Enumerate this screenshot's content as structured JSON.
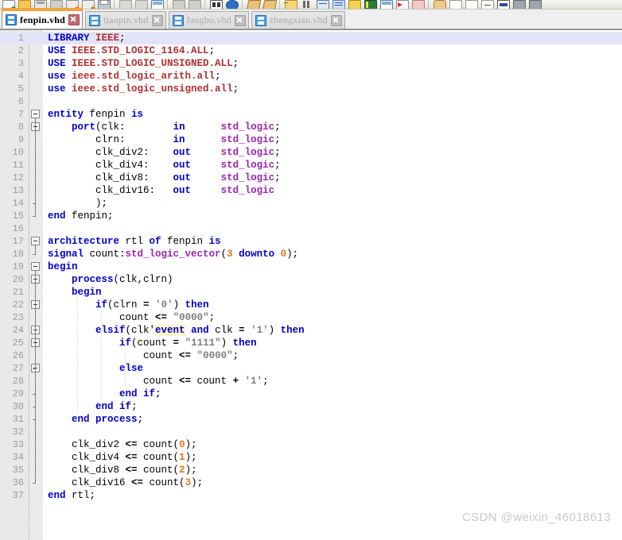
{
  "toolbar": {
    "name": "main-toolbar",
    "icons": [
      "new-file-icon",
      "open-folder-icon",
      "save-icon",
      "save-all-icon",
      "print-preview-icon",
      "print-setup-icon",
      "print-icon",
      "sep",
      "cut-icon",
      "copy-icon",
      "paste-icon",
      "sep",
      "undo-icon",
      "redo-icon",
      "sep",
      "find-icon",
      "find-replace-icon",
      "sep",
      "insert-template-icon",
      "insert-signal-icon",
      "sep",
      "compile-add-icon",
      "pause-icon",
      "simulate-icon",
      "run-icon",
      "waveform-icon",
      "report-icon",
      "delete-icon",
      "stop-icon",
      "hand-icon",
      "sep",
      "panel-1-icon",
      "panel-2-icon",
      "panel-3-icon",
      "panel-4-icon",
      "panel-5-icon"
    ]
  },
  "tabs": [
    {
      "label": "fenpin.vhd",
      "active": true,
      "icon": "file-save-icon",
      "close": "close-icon"
    },
    {
      "label": "tiaopin.vhd",
      "active": false,
      "icon": "file-save-icon",
      "close": "close-icon"
    },
    {
      "label": "fangbo.vhd",
      "active": false,
      "icon": "file-save-icon",
      "close": "close-icon"
    },
    {
      "label": "zhengxian.vhd",
      "active": false,
      "icon": "file-save-icon",
      "close": "close-icon"
    }
  ],
  "editor": {
    "name": "vhdl-source-editor",
    "current_line": 1,
    "total_lines": 37,
    "colors": {
      "current_line_bg": "#e4e4f8",
      "keyword": "#0000d0",
      "type": "#9c27b0",
      "library": "#b03030",
      "number": "#e07a1f",
      "string": "#808080",
      "search_highlight_bg": "#fbf6c4",
      "gutter_bg": "#e9e9e9",
      "line_number": "#9b9b9b"
    },
    "lines": [
      {
        "n": 1,
        "tokens": [
          {
            "t": "LIBRARY",
            "c": "kw"
          },
          {
            "t": " ",
            "c": "pl"
          },
          {
            "t": "IEEE",
            "c": "lib"
          },
          {
            "t": ";",
            "c": "pl"
          }
        ]
      },
      {
        "n": 2,
        "tokens": [
          {
            "t": "USE",
            "c": "kw"
          },
          {
            "t": " ",
            "c": "pl"
          },
          {
            "t": "IEEE.STD_LOGIC_1164.ALL",
            "c": "lib"
          },
          {
            "t": ";",
            "c": "pl"
          }
        ]
      },
      {
        "n": 3,
        "tokens": [
          {
            "t": "USE",
            "c": "kw"
          },
          {
            "t": " ",
            "c": "pl"
          },
          {
            "t": "IEEE.STD_LOGIC_UNSIGNED.ALL",
            "c": "lib"
          },
          {
            "t": ";",
            "c": "pl"
          }
        ]
      },
      {
        "n": 4,
        "tokens": [
          {
            "t": "use",
            "c": "kw"
          },
          {
            "t": " ",
            "c": "pl"
          },
          {
            "t": "ieee.std_logic_arith.all",
            "c": "lib"
          },
          {
            "t": ";",
            "c": "pl"
          }
        ]
      },
      {
        "n": 5,
        "tokens": [
          {
            "t": "use",
            "c": "kw"
          },
          {
            "t": " ",
            "c": "pl"
          },
          {
            "t": "ieee.std_logic_unsigned.all",
            "c": "lib"
          },
          {
            "t": ";",
            "c": "pl"
          }
        ]
      },
      {
        "n": 6,
        "tokens": []
      },
      {
        "n": 7,
        "tokens": [
          {
            "t": "entity",
            "c": "kw"
          },
          {
            "t": " fenpin ",
            "c": "pl"
          },
          {
            "t": "is",
            "c": "kw"
          }
        ]
      },
      {
        "n": 8,
        "tokens": [
          {
            "t": "    ",
            "c": "pl"
          },
          {
            "t": "port",
            "c": "kw"
          },
          {
            "t": "(clk:        ",
            "c": "pl"
          },
          {
            "t": "in",
            "c": "kw"
          },
          {
            "t": "      ",
            "c": "pl"
          },
          {
            "t": "std_logic",
            "c": "ty"
          },
          {
            "t": ";",
            "c": "pl"
          }
        ]
      },
      {
        "n": 9,
        "tokens": [
          {
            "t": "        clrn:        ",
            "c": "pl"
          },
          {
            "t": "in",
            "c": "kw"
          },
          {
            "t": "      ",
            "c": "pl"
          },
          {
            "t": "std_logic",
            "c": "ty"
          },
          {
            "t": ";",
            "c": "pl"
          }
        ]
      },
      {
        "n": 10,
        "tokens": [
          {
            "t": "        clk_div2:    ",
            "c": "pl"
          },
          {
            "t": "out",
            "c": "kw"
          },
          {
            "t": "     ",
            "c": "pl"
          },
          {
            "t": "std_logic",
            "c": "ty"
          },
          {
            "t": ";",
            "c": "pl"
          }
        ]
      },
      {
        "n": 11,
        "tokens": [
          {
            "t": "        clk_div4:    ",
            "c": "pl"
          },
          {
            "t": "out",
            "c": "kw"
          },
          {
            "t": "     ",
            "c": "pl"
          },
          {
            "t": "std_logic",
            "c": "ty"
          },
          {
            "t": ";",
            "c": "pl"
          }
        ]
      },
      {
        "n": 12,
        "tokens": [
          {
            "t": "        clk_div8:    ",
            "c": "pl"
          },
          {
            "t": "out",
            "c": "kw"
          },
          {
            "t": "     ",
            "c": "pl"
          },
          {
            "t": "std_logic",
            "c": "ty"
          },
          {
            "t": ";",
            "c": "pl"
          }
        ]
      },
      {
        "n": 13,
        "tokens": [
          {
            "t": "        clk_div16:   ",
            "c": "pl"
          },
          {
            "t": "out",
            "c": "kw"
          },
          {
            "t": "     ",
            "c": "pl"
          },
          {
            "t": "std_logic",
            "c": "ty"
          }
        ]
      },
      {
        "n": 14,
        "tokens": [
          {
            "t": "        );",
            "c": "pl"
          }
        ]
      },
      {
        "n": 15,
        "tokens": [
          {
            "t": "end",
            "c": "kw"
          },
          {
            "t": " fenpin;",
            "c": "pl"
          }
        ]
      },
      {
        "n": 16,
        "tokens": []
      },
      {
        "n": 17,
        "tokens": [
          {
            "t": "architecture",
            "c": "kw"
          },
          {
            "t": " rtl ",
            "c": "pl"
          },
          {
            "t": "of",
            "c": "kw"
          },
          {
            "t": " fenpin ",
            "c": "pl"
          },
          {
            "t": "is",
            "c": "kw"
          }
        ]
      },
      {
        "n": 18,
        "tokens": [
          {
            "t": "signal",
            "c": "kw"
          },
          {
            "t": " count:",
            "c": "pl"
          },
          {
            "t": "std_logic_vector",
            "c": "ty"
          },
          {
            "t": "(",
            "c": "pl"
          },
          {
            "t": "3",
            "c": "num"
          },
          {
            "t": " ",
            "c": "pl"
          },
          {
            "t": "downto",
            "c": "kw"
          },
          {
            "t": " ",
            "c": "pl"
          },
          {
            "t": "0",
            "c": "num"
          },
          {
            "t": ");",
            "c": "pl"
          }
        ]
      },
      {
        "n": 19,
        "tokens": [
          {
            "t": "begin",
            "c": "kw"
          }
        ]
      },
      {
        "n": 20,
        "tokens": [
          {
            "t": "    ",
            "c": "pl"
          },
          {
            "t": "process",
            "c": "kw"
          },
          {
            "t": "(clk,clrn)",
            "c": "pl"
          }
        ]
      },
      {
        "n": 21,
        "tokens": [
          {
            "t": "    ",
            "c": "pl"
          },
          {
            "t": "begin",
            "c": "kw"
          }
        ]
      },
      {
        "n": 22,
        "tokens": [
          {
            "t": "        ",
            "c": "pl"
          },
          {
            "t": "if",
            "c": "kw"
          },
          {
            "t": "(clrn ",
            "c": "pl"
          },
          {
            "t": "=",
            "c": "op"
          },
          {
            "t": " ",
            "c": "pl"
          },
          {
            "t": "'0'",
            "c": "str"
          },
          {
            "t": ") ",
            "c": "pl"
          },
          {
            "t": "then",
            "c": "kw"
          }
        ]
      },
      {
        "n": 23,
        "tokens": [
          {
            "t": "            count ",
            "c": "pl"
          },
          {
            "t": "<=",
            "c": "op"
          },
          {
            "t": " ",
            "c": "pl"
          },
          {
            "t": "\"0000\"",
            "c": "str"
          },
          {
            "t": ";",
            "c": "pl"
          }
        ]
      },
      {
        "n": 24,
        "tokens": [
          {
            "t": "        ",
            "c": "pl"
          },
          {
            "t": "elsif",
            "c": "kw"
          },
          {
            "t": "(clk'",
            "c": "pl"
          },
          {
            "t": "event",
            "c": "kw hl"
          },
          {
            "t": " ",
            "c": "pl"
          },
          {
            "t": "and",
            "c": "kw"
          },
          {
            "t": " clk ",
            "c": "pl"
          },
          {
            "t": "=",
            "c": "op"
          },
          {
            "t": " ",
            "c": "pl"
          },
          {
            "t": "'1'",
            "c": "str"
          },
          {
            "t": ") ",
            "c": "pl"
          },
          {
            "t": "then",
            "c": "kw"
          }
        ]
      },
      {
        "n": 25,
        "tokens": [
          {
            "t": "            ",
            "c": "pl"
          },
          {
            "t": "if",
            "c": "kw"
          },
          {
            "t": "(count ",
            "c": "pl"
          },
          {
            "t": "=",
            "c": "op"
          },
          {
            "t": " ",
            "c": "pl"
          },
          {
            "t": "\"1111\"",
            "c": "str"
          },
          {
            "t": ") ",
            "c": "pl"
          },
          {
            "t": "then",
            "c": "kw"
          }
        ]
      },
      {
        "n": 26,
        "tokens": [
          {
            "t": "                count ",
            "c": "pl"
          },
          {
            "t": "<=",
            "c": "op"
          },
          {
            "t": " ",
            "c": "pl"
          },
          {
            "t": "\"0000\"",
            "c": "str"
          },
          {
            "t": ";",
            "c": "pl"
          }
        ]
      },
      {
        "n": 27,
        "tokens": [
          {
            "t": "            ",
            "c": "pl"
          },
          {
            "t": "else",
            "c": "kw"
          }
        ]
      },
      {
        "n": 28,
        "tokens": [
          {
            "t": "                count ",
            "c": "pl"
          },
          {
            "t": "<=",
            "c": "op"
          },
          {
            "t": " count ",
            "c": "pl"
          },
          {
            "t": "+",
            "c": "op"
          },
          {
            "t": " ",
            "c": "pl"
          },
          {
            "t": "'1'",
            "c": "str"
          },
          {
            "t": ";",
            "c": "pl"
          }
        ]
      },
      {
        "n": 29,
        "tokens": [
          {
            "t": "            ",
            "c": "pl"
          },
          {
            "t": "end",
            "c": "kw"
          },
          {
            "t": " ",
            "c": "pl"
          },
          {
            "t": "if",
            "c": "kw"
          },
          {
            "t": ";",
            "c": "pl"
          }
        ]
      },
      {
        "n": 30,
        "tokens": [
          {
            "t": "        ",
            "c": "pl"
          },
          {
            "t": "end",
            "c": "kw"
          },
          {
            "t": " ",
            "c": "pl"
          },
          {
            "t": "if",
            "c": "kw"
          },
          {
            "t": ";",
            "c": "pl"
          }
        ]
      },
      {
        "n": 31,
        "tokens": [
          {
            "t": "    ",
            "c": "pl"
          },
          {
            "t": "end",
            "c": "kw"
          },
          {
            "t": " ",
            "c": "pl"
          },
          {
            "t": "process",
            "c": "kw"
          },
          {
            "t": ";",
            "c": "pl"
          }
        ]
      },
      {
        "n": 32,
        "tokens": []
      },
      {
        "n": 33,
        "tokens": [
          {
            "t": "    clk_div2 ",
            "c": "pl"
          },
          {
            "t": "<=",
            "c": "op"
          },
          {
            "t": " count(",
            "c": "pl"
          },
          {
            "t": "0",
            "c": "num"
          },
          {
            "t": ");",
            "c": "pl"
          }
        ]
      },
      {
        "n": 34,
        "tokens": [
          {
            "t": "    clk_div4 ",
            "c": "pl"
          },
          {
            "t": "<=",
            "c": "op"
          },
          {
            "t": " count(",
            "c": "pl"
          },
          {
            "t": "1",
            "c": "num"
          },
          {
            "t": ");",
            "c": "pl"
          }
        ]
      },
      {
        "n": 35,
        "tokens": [
          {
            "t": "    clk_div8 ",
            "c": "pl"
          },
          {
            "t": "<=",
            "c": "op"
          },
          {
            "t": " count(",
            "c": "pl"
          },
          {
            "t": "2",
            "c": "num"
          },
          {
            "t": ");",
            "c": "pl"
          }
        ]
      },
      {
        "n": 36,
        "tokens": [
          {
            "t": "    clk_div16 ",
            "c": "pl"
          },
          {
            "t": "<=",
            "c": "op"
          },
          {
            "t": " count(",
            "c": "pl"
          },
          {
            "t": "3",
            "c": "num"
          },
          {
            "t": ");",
            "c": "pl"
          }
        ]
      },
      {
        "n": 37,
        "tokens": [
          {
            "t": "end",
            "c": "kw"
          },
          {
            "t": " rtl;",
            "c": "pl"
          }
        ]
      }
    ],
    "fold_markers": [
      {
        "line": 7,
        "state": "expanded"
      },
      {
        "line": 8,
        "state": "expanded"
      },
      {
        "line": 17,
        "state": "expanded"
      },
      {
        "line": 19,
        "state": "expanded"
      },
      {
        "line": 20,
        "state": "expanded"
      },
      {
        "line": 22,
        "state": "expanded"
      },
      {
        "line": 24,
        "state": "expanded"
      },
      {
        "line": 25,
        "state": "expanded"
      },
      {
        "line": 27,
        "state": "expanded"
      }
    ]
  },
  "watermark": {
    "text": "CSDN @weixin_46018613"
  }
}
